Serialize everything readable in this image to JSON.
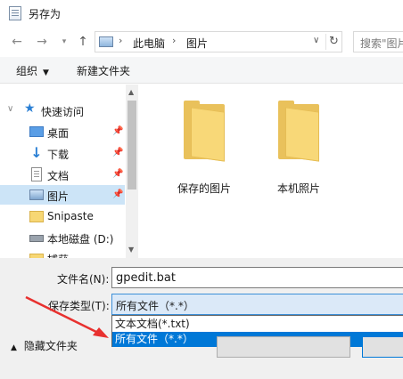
{
  "window": {
    "title": "另存为"
  },
  "address": {
    "crumbs": [
      "此电脑",
      "图片"
    ],
    "search_placeholder": "搜索\"图片\""
  },
  "toolbar": {
    "organize": "组织",
    "new_folder": "新建文件夹"
  },
  "sidebar": {
    "quick_access": "快速访问",
    "items": [
      {
        "label": "桌面",
        "icon": "desktop-icon"
      },
      {
        "label": "下载",
        "icon": "download-icon"
      },
      {
        "label": "文档",
        "icon": "document-icon"
      },
      {
        "label": "图片",
        "icon": "pictures-icon"
      },
      {
        "label": "Snipaste",
        "icon": "folder-icon"
      },
      {
        "label": "本地磁盘 (D:)",
        "icon": "drive-icon"
      },
      {
        "label": "捕获",
        "icon": "folder-icon"
      }
    ]
  },
  "content": {
    "folders": [
      {
        "name": "保存的图片"
      },
      {
        "name": "本机照片"
      }
    ]
  },
  "save": {
    "filename_label": "文件名(N):",
    "filename_value": "gpedit.bat",
    "filetype_label": "保存类型(T):",
    "filetype_value": "所有文件（*.*）",
    "filetype_options": [
      "文本文档(*.txt)",
      "所有文件（*.*）"
    ],
    "hide_folders": "隐藏文件夹"
  },
  "colors": {
    "selection": "#0078d7",
    "annotation_arrow": "#e8312f",
    "folder": "#f8d878"
  }
}
